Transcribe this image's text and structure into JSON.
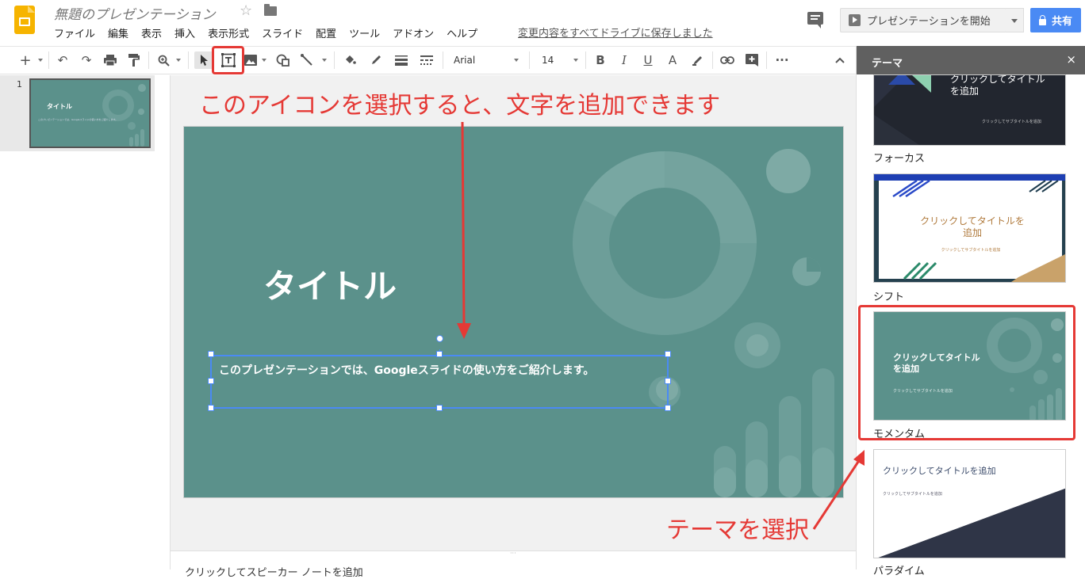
{
  "header": {
    "doc_title": "無題のプレゼンテーション",
    "menu": [
      "ファイル",
      "編集",
      "表示",
      "挿入",
      "表示形式",
      "スライド",
      "配置",
      "ツール",
      "アドオン",
      "ヘルプ"
    ],
    "save_status": "変更内容をすべてドライブに保存しました",
    "present_label": "プレゼンテーションを開始",
    "share_label": "共有"
  },
  "toolbar": {
    "font_name": "Arial",
    "font_size": "14"
  },
  "filmstrip": {
    "slide_number": "1",
    "thumb_title": "タイトル",
    "thumb_subtitle": "このプレゼンテーションでは、Googleスライドの使い方をご紹介します。"
  },
  "slide": {
    "title": "タイトル",
    "subtitle": "このプレゼンテーションでは、Googleスライドの使い方をご紹介します。"
  },
  "notes": {
    "placeholder": "クリックしてスピーカー ノートを追加"
  },
  "theme_panel": {
    "header": "テーマ",
    "close": "×",
    "themes": [
      {
        "name": "フォーカス",
        "title": "クリックしてタイトルを追加",
        "subtitle": "クリックしてサブタイトルを追加"
      },
      {
        "name": "シフト",
        "title": "クリックしてタイトルを追加",
        "subtitle": "クリックしてサブタイトルを追加"
      },
      {
        "name": "モメンタム",
        "title": "クリックしてタイトルを追加",
        "subtitle": "クリックしてサブタイトルを追加"
      },
      {
        "name": "パラダイム",
        "title": "クリックしてタイトルを追加",
        "subtitle": "クリックしてサブタイトルを追加"
      }
    ]
  },
  "annotations": {
    "textbox_hint": "このアイコンを選択すると、文字を追加できます",
    "theme_hint": "テーマを選択"
  },
  "colors": {
    "accent_red": "#e53935",
    "slide_teal": "#5b918b",
    "share_blue": "#4a8af4",
    "selection_blue": "#4a8af4"
  }
}
